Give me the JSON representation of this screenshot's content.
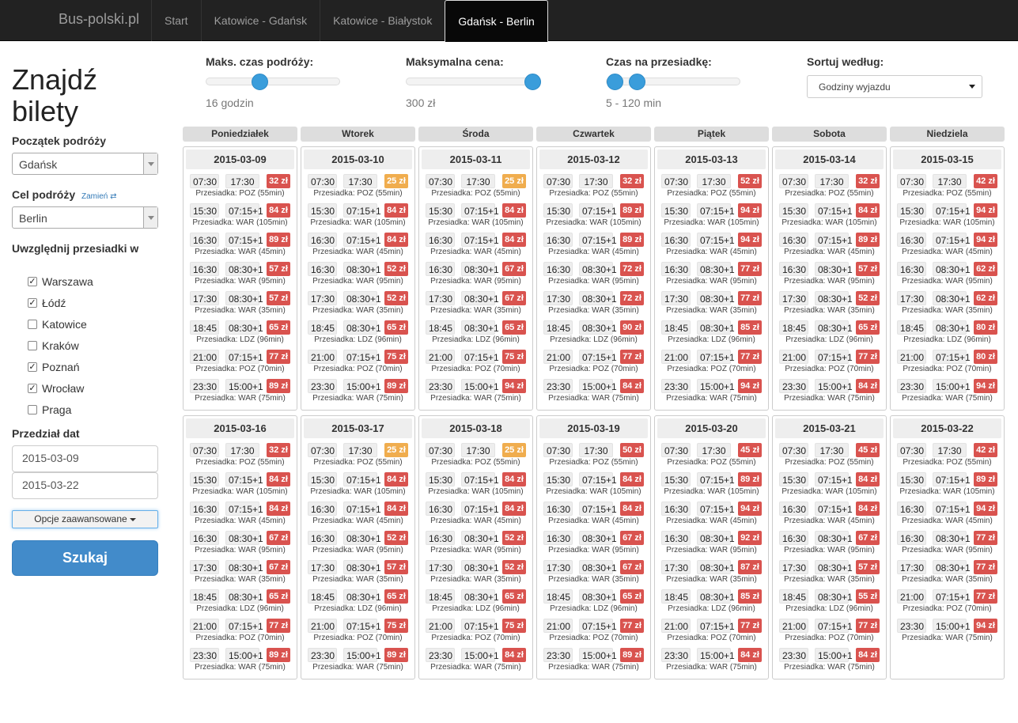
{
  "nav": {
    "brand": "Bus-polski.pl",
    "items": [
      {
        "label": "Start",
        "name": "nav-start"
      },
      {
        "label": "Katowice - Gdańsk",
        "name": "nav-katowice-gdansk"
      },
      {
        "label": "Katowice - Białystok",
        "name": "nav-katowice-bialystok"
      },
      {
        "label": "Gdańsk - Berlin",
        "name": "nav-gdansk-berlin",
        "active": true
      }
    ]
  },
  "sidebar": {
    "title": "Znajdź bilety",
    "start_label": "Początek podróży",
    "start_value": "Gdańsk",
    "dest_label": "Cel podróży",
    "swap_label": "Zamień",
    "dest_value": "Berlin",
    "transfers_label": "Uwzględnij przesiadki w",
    "transfers": [
      {
        "city": "Warszawa",
        "checked": true
      },
      {
        "city": "Łódź",
        "checked": true
      },
      {
        "city": "Katowice",
        "checked": false
      },
      {
        "city": "Kraków",
        "checked": false
      },
      {
        "city": "Poznań",
        "checked": true
      },
      {
        "city": "Wrocław",
        "checked": true
      },
      {
        "city": "Praga",
        "checked": false
      }
    ],
    "date_range_label": "Przedział dat",
    "date_from": "2015-03-09",
    "date_to": "2015-03-22",
    "advanced_label": "Opcje zaawansowane",
    "search_label": "Szukaj"
  },
  "filters": {
    "max_time": {
      "label": "Maks. czas podróży:",
      "value": "16 godzin",
      "level": 0.38
    },
    "max_price": {
      "label": "Maksymalna cena:",
      "value": "300 zł",
      "level": 1.0
    },
    "transfer_time": {
      "label": "Czas na przesiadkę:",
      "value": "5 - 120 min",
      "low": 0.0,
      "high": 0.19
    },
    "sort": {
      "label": "Sortuj według:",
      "value": "Godziny wyjazdu"
    }
  },
  "calendar": {
    "days": [
      "Poniedziałek",
      "Wtorek",
      "Środa",
      "Czwartek",
      "Piątek",
      "Sobota",
      "Niedziela"
    ],
    "weeks": [
      [
        {
          "date": "2015-03-09",
          "trips": [
            [
              "07:30",
              "17:30",
              "32 zł",
              "Przesiadka: POZ (55min)"
            ],
            [
              "15:30",
              "07:15+1",
              "84 zł",
              "Przesiadka: WAR (105min)"
            ],
            [
              "16:30",
              "07:15+1",
              "89 zł",
              "Przesiadka: WAR (45min)"
            ],
            [
              "16:30",
              "08:30+1",
              "57 zł",
              "Przesiadka: WAR (95min)"
            ],
            [
              "17:30",
              "08:30+1",
              "57 zł",
              "Przesiadka: WAR (35min)"
            ],
            [
              "18:45",
              "08:30+1",
              "65 zł",
              "Przesiadka: LDZ (96min)"
            ],
            [
              "21:00",
              "07:15+1",
              "77 zł",
              "Przesiadka: POZ (70min)"
            ],
            [
              "23:30",
              "15:00+1",
              "89 zł",
              "Przesiadka: WAR (75min)"
            ]
          ]
        },
        {
          "date": "2015-03-10",
          "trips": [
            [
              "07:30",
              "17:30",
              "25 zł",
              "Przesiadka: POZ (55min)"
            ],
            [
              "15:30",
              "07:15+1",
              "84 zł",
              "Przesiadka: WAR (105min)"
            ],
            [
              "16:30",
              "07:15+1",
              "84 zł",
              "Przesiadka: WAR (45min)"
            ],
            [
              "16:30",
              "08:30+1",
              "52 zł",
              "Przesiadka: WAR (95min)"
            ],
            [
              "17:30",
              "08:30+1",
              "52 zł",
              "Przesiadka: WAR (35min)"
            ],
            [
              "18:45",
              "08:30+1",
              "65 zł",
              "Przesiadka: LDZ (96min)"
            ],
            [
              "21:00",
              "07:15+1",
              "75 zł",
              "Przesiadka: POZ (70min)"
            ],
            [
              "23:30",
              "15:00+1",
              "89 zł",
              "Przesiadka: WAR (75min)"
            ]
          ]
        },
        {
          "date": "2015-03-11",
          "trips": [
            [
              "07:30",
              "17:30",
              "25 zł",
              "Przesiadka: POZ (55min)"
            ],
            [
              "15:30",
              "07:15+1",
              "84 zł",
              "Przesiadka: WAR (105min)"
            ],
            [
              "16:30",
              "07:15+1",
              "84 zł",
              "Przesiadka: WAR (45min)"
            ],
            [
              "16:30",
              "08:30+1",
              "67 zł",
              "Przesiadka: WAR (95min)"
            ],
            [
              "17:30",
              "08:30+1",
              "67 zł",
              "Przesiadka: WAR (35min)"
            ],
            [
              "18:45",
              "08:30+1",
              "65 zł",
              "Przesiadka: LDZ (96min)"
            ],
            [
              "21:00",
              "07:15+1",
              "75 zł",
              "Przesiadka: POZ (70min)"
            ],
            [
              "23:30",
              "15:00+1",
              "94 zł",
              "Przesiadka: WAR (75min)"
            ]
          ]
        },
        {
          "date": "2015-03-12",
          "trips": [
            [
              "07:30",
              "17:30",
              "32 zł",
              "Przesiadka: POZ (55min)"
            ],
            [
              "15:30",
              "07:15+1",
              "89 zł",
              "Przesiadka: WAR (105min)"
            ],
            [
              "16:30",
              "07:15+1",
              "89 zł",
              "Przesiadka: WAR (45min)"
            ],
            [
              "16:30",
              "08:30+1",
              "72 zł",
              "Przesiadka: WAR (95min)"
            ],
            [
              "17:30",
              "08:30+1",
              "72 zł",
              "Przesiadka: WAR (35min)"
            ],
            [
              "18:45",
              "08:30+1",
              "90 zł",
              "Przesiadka: LDZ (96min)"
            ],
            [
              "21:00",
              "07:15+1",
              "77 zł",
              "Przesiadka: POZ (70min)"
            ],
            [
              "23:30",
              "15:00+1",
              "84 zł",
              "Przesiadka: WAR (75min)"
            ]
          ]
        },
        {
          "date": "2015-03-13",
          "trips": [
            [
              "07:30",
              "17:30",
              "52 zł",
              "Przesiadka: POZ (55min)"
            ],
            [
              "15:30",
              "07:15+1",
              "94 zł",
              "Przesiadka: WAR (105min)"
            ],
            [
              "16:30",
              "07:15+1",
              "94 zł",
              "Przesiadka: WAR (45min)"
            ],
            [
              "16:30",
              "08:30+1",
              "77 zł",
              "Przesiadka: WAR (95min)"
            ],
            [
              "17:30",
              "08:30+1",
              "77 zł",
              "Przesiadka: WAR (35min)"
            ],
            [
              "18:45",
              "08:30+1",
              "85 zł",
              "Przesiadka: LDZ (96min)"
            ],
            [
              "21:00",
              "07:15+1",
              "77 zł",
              "Przesiadka: POZ (70min)"
            ],
            [
              "23:30",
              "15:00+1",
              "94 zł",
              "Przesiadka: WAR (75min)"
            ]
          ]
        },
        {
          "date": "2015-03-14",
          "trips": [
            [
              "07:30",
              "17:30",
              "32 zł",
              "Przesiadka: POZ (55min)"
            ],
            [
              "15:30",
              "07:15+1",
              "84 zł",
              "Przesiadka: WAR (105min)"
            ],
            [
              "16:30",
              "07:15+1",
              "89 zł",
              "Przesiadka: WAR (45min)"
            ],
            [
              "16:30",
              "08:30+1",
              "57 zł",
              "Przesiadka: WAR (95min)"
            ],
            [
              "17:30",
              "08:30+1",
              "52 zł",
              "Przesiadka: WAR (35min)"
            ],
            [
              "18:45",
              "08:30+1",
              "65 zł",
              "Przesiadka: LDZ (96min)"
            ],
            [
              "21:00",
              "07:15+1",
              "77 zł",
              "Przesiadka: POZ (70min)"
            ],
            [
              "23:30",
              "15:00+1",
              "84 zł",
              "Przesiadka: WAR (75min)"
            ]
          ]
        },
        {
          "date": "2015-03-15",
          "trips": [
            [
              "07:30",
              "17:30",
              "42 zł",
              "Przesiadka: POZ (55min)"
            ],
            [
              "15:30",
              "07:15+1",
              "94 zł",
              "Przesiadka: WAR (105min)"
            ],
            [
              "16:30",
              "07:15+1",
              "94 zł",
              "Przesiadka: WAR (45min)"
            ],
            [
              "16:30",
              "08:30+1",
              "62 zł",
              "Przesiadka: WAR (95min)"
            ],
            [
              "17:30",
              "08:30+1",
              "62 zł",
              "Przesiadka: WAR (35min)"
            ],
            [
              "18:45",
              "08:30+1",
              "80 zł",
              "Przesiadka: LDZ (96min)"
            ],
            [
              "21:00",
              "07:15+1",
              "80 zł",
              "Przesiadka: POZ (70min)"
            ],
            [
              "23:30",
              "15:00+1",
              "94 zł",
              "Przesiadka: WAR (75min)"
            ]
          ]
        }
      ],
      [
        {
          "date": "2015-03-16",
          "trips": [
            [
              "07:30",
              "17:30",
              "32 zł",
              "Przesiadka: POZ (55min)"
            ],
            [
              "15:30",
              "07:15+1",
              "84 zł",
              "Przesiadka: WAR (105min)"
            ],
            [
              "16:30",
              "07:15+1",
              "84 zł",
              "Przesiadka: WAR (45min)"
            ],
            [
              "16:30",
              "08:30+1",
              "67 zł",
              "Przesiadka: WAR (95min)"
            ],
            [
              "17:30",
              "08:30+1",
              "67 zł",
              "Przesiadka: WAR (35min)"
            ],
            [
              "18:45",
              "08:30+1",
              "65 zł",
              "Przesiadka: LDZ (96min)"
            ],
            [
              "21:00",
              "07:15+1",
              "77 zł",
              "Przesiadka: POZ (70min)"
            ],
            [
              "23:30",
              "15:00+1",
              "89 zł",
              "Przesiadka: WAR (75min)"
            ]
          ]
        },
        {
          "date": "2015-03-17",
          "trips": [
            [
              "07:30",
              "17:30",
              "25 zł",
              "Przesiadka: POZ (55min)"
            ],
            [
              "15:30",
              "07:15+1",
              "84 zł",
              "Przesiadka: WAR (105min)"
            ],
            [
              "16:30",
              "07:15+1",
              "84 zł",
              "Przesiadka: WAR (45min)"
            ],
            [
              "16:30",
              "08:30+1",
              "52 zł",
              "Przesiadka: WAR (95min)"
            ],
            [
              "17:30",
              "08:30+1",
              "57 zł",
              "Przesiadka: WAR (35min)"
            ],
            [
              "18:45",
              "08:30+1",
              "65 zł",
              "Przesiadka: LDZ (96min)"
            ],
            [
              "21:00",
              "07:15+1",
              "75 zł",
              "Przesiadka: POZ (70min)"
            ],
            [
              "23:30",
              "15:00+1",
              "89 zł",
              "Przesiadka: WAR (75min)"
            ]
          ]
        },
        {
          "date": "2015-03-18",
          "trips": [
            [
              "07:30",
              "17:30",
              "25 zł",
              "Przesiadka: POZ (55min)"
            ],
            [
              "15:30",
              "07:15+1",
              "84 zł",
              "Przesiadka: WAR (105min)"
            ],
            [
              "16:30",
              "07:15+1",
              "84 zł",
              "Przesiadka: WAR (45min)"
            ],
            [
              "16:30",
              "08:30+1",
              "52 zł",
              "Przesiadka: WAR (95min)"
            ],
            [
              "17:30",
              "08:30+1",
              "52 zł",
              "Przesiadka: WAR (35min)"
            ],
            [
              "18:45",
              "08:30+1",
              "65 zł",
              "Przesiadka: LDZ (96min)"
            ],
            [
              "21:00",
              "07:15+1",
              "75 zł",
              "Przesiadka: POZ (70min)"
            ],
            [
              "23:30",
              "15:00+1",
              "84 zł",
              "Przesiadka: WAR (75min)"
            ]
          ]
        },
        {
          "date": "2015-03-19",
          "trips": [
            [
              "07:30",
              "17:30",
              "50 zł",
              "Przesiadka: POZ (55min)"
            ],
            [
              "15:30",
              "07:15+1",
              "84 zł",
              "Przesiadka: WAR (105min)"
            ],
            [
              "16:30",
              "07:15+1",
              "84 zł",
              "Przesiadka: WAR (45min)"
            ],
            [
              "16:30",
              "08:30+1",
              "67 zł",
              "Przesiadka: WAR (95min)"
            ],
            [
              "17:30",
              "08:30+1",
              "67 zł",
              "Przesiadka: WAR (35min)"
            ],
            [
              "18:45",
              "08:30+1",
              "65 zł",
              "Przesiadka: LDZ (96min)"
            ],
            [
              "21:00",
              "07:15+1",
              "77 zł",
              "Przesiadka: POZ (70min)"
            ],
            [
              "23:30",
              "15:00+1",
              "89 zł",
              "Przesiadka: WAR (75min)"
            ]
          ]
        },
        {
          "date": "2015-03-20",
          "trips": [
            [
              "07:30",
              "17:30",
              "45 zł",
              "Przesiadka: POZ (55min)"
            ],
            [
              "15:30",
              "07:15+1",
              "89 zł",
              "Przesiadka: WAR (105min)"
            ],
            [
              "16:30",
              "07:15+1",
              "94 zł",
              "Przesiadka: WAR (45min)"
            ],
            [
              "16:30",
              "08:30+1",
              "92 zł",
              "Przesiadka: WAR (95min)"
            ],
            [
              "17:30",
              "08:30+1",
              "87 zł",
              "Przesiadka: WAR (35min)"
            ],
            [
              "18:45",
              "08:30+1",
              "85 zł",
              "Przesiadka: LDZ (96min)"
            ],
            [
              "21:00",
              "07:15+1",
              "77 zł",
              "Przesiadka: POZ (70min)"
            ],
            [
              "23:30",
              "15:00+1",
              "84 zł",
              "Przesiadka: WAR (75min)"
            ]
          ]
        },
        {
          "date": "2015-03-21",
          "trips": [
            [
              "07:30",
              "17:30",
              "45 zł",
              "Przesiadka: POZ (55min)"
            ],
            [
              "15:30",
              "07:15+1",
              "84 zł",
              "Przesiadka: WAR (105min)"
            ],
            [
              "16:30",
              "07:15+1",
              "84 zł",
              "Przesiadka: WAR (45min)"
            ],
            [
              "16:30",
              "08:30+1",
              "67 zł",
              "Przesiadka: WAR (95min)"
            ],
            [
              "17:30",
              "08:30+1",
              "57 zł",
              "Przesiadka: WAR (35min)"
            ],
            [
              "18:45",
              "08:30+1",
              "55 zł",
              "Przesiadka: LDZ (96min)"
            ],
            [
              "21:00",
              "07:15+1",
              "77 zł",
              "Przesiadka: POZ (70min)"
            ],
            [
              "23:30",
              "15:00+1",
              "84 zł",
              "Przesiadka: WAR (75min)"
            ]
          ]
        },
        {
          "date": "2015-03-22",
          "trips": [
            [
              "07:30",
              "17:30",
              "42 zł",
              "Przesiadka: POZ (55min)"
            ],
            [
              "15:30",
              "07:15+1",
              "89 zł",
              "Przesiadka: WAR (105min)"
            ],
            [
              "16:30",
              "07:15+1",
              "94 zł",
              "Przesiadka: WAR (45min)"
            ],
            [
              "16:30",
              "08:30+1",
              "77 zł",
              "Przesiadka: WAR (95min)"
            ],
            [
              "17:30",
              "08:30+1",
              "77 zł",
              "Przesiadka: WAR (35min)"
            ],
            [
              "21:00",
              "07:15+1",
              "77 zł",
              "Przesiadka: POZ (70min)"
            ],
            [
              "23:30",
              "15:00+1",
              "94 zł",
              "Przesiadka: WAR (75min)"
            ]
          ]
        }
      ]
    ]
  },
  "colors": {
    "price_red": "#d9534f",
    "price_cheap": "#f0ad4e",
    "slider": "#3a9ddb",
    "primary": "#428bca"
  }
}
